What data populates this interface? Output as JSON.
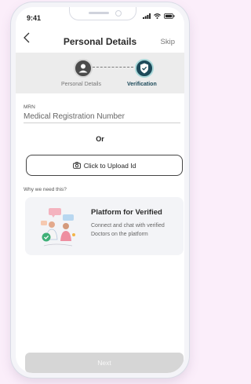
{
  "status_bar": {
    "time": "9:41",
    "icons": [
      "signal-icon",
      "wifi-icon",
      "battery-icon"
    ]
  },
  "header": {
    "title": "Personal Details",
    "back_icon": "chevron-left-icon",
    "skip_label": "Skip"
  },
  "stepper": {
    "steps": [
      {
        "label": "Personal Details",
        "icon": "person-icon",
        "state": "done"
      },
      {
        "label": "Verification",
        "icon": "shield-check-icon",
        "state": "active"
      }
    ]
  },
  "mrn": {
    "label": "MRN",
    "placeholder": "Medical Registration Number",
    "value": ""
  },
  "divider_text": "Or",
  "upload": {
    "label": "Click to Upload Id",
    "icon": "camera-icon"
  },
  "why_text": "Why we need this?",
  "info_card": {
    "title": "Platform for Verified",
    "description": "Connect and chat with verified Doctors on the platform",
    "illustration": "verified-doctors-illustration"
  },
  "next_label": "Next",
  "colors": {
    "background": "#fbeefa",
    "accent": "#1d4a5a",
    "stepper_bg": "#ececec",
    "card_bg": "#f3f4f7",
    "disabled_button": "#d6d6d6"
  }
}
